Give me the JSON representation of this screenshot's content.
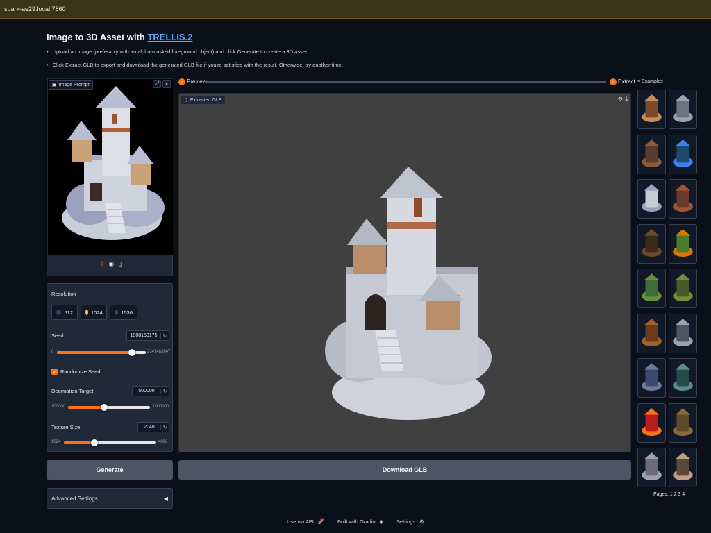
{
  "browser": {
    "url": "spark-ae29.local:7860"
  },
  "header": {
    "title_prefix": "Image to 3D Asset with ",
    "title_link": "TRELLIS.2",
    "instructions": [
      "Upload an image (preferably with an alpha-masked foreground object) and click Generate to create a 3D asset.",
      "Click Extract GLB to export and download the generated GLB file if you're satisfied with the result. Otherwise, try another time."
    ]
  },
  "image_prompt": {
    "label": "Image Prompt"
  },
  "settings": {
    "resolution_label": "Resolution",
    "resolution_options": [
      "512",
      "1024",
      "1536"
    ],
    "resolution_selected": "1024",
    "seed_label": "Seed",
    "seed_value": "1808159175",
    "seed_min": "0",
    "seed_max": "2147483647",
    "seed_fraction": 0.84,
    "randomize_label": "Randomize Seed",
    "randomize_checked": true,
    "decimation_label": "Decimation Target",
    "decimation_value": "500000",
    "decimation_min": "100000",
    "decimation_max": "1000000",
    "decimation_fraction": 0.44,
    "texture_label": "Texture Size",
    "texture_value": "2048",
    "texture_min": "1024",
    "texture_max": "4096",
    "texture_fraction": 0.33
  },
  "buttons": {
    "generate": "Generate",
    "download": "Download GLB",
    "advanced": "Advanced Settings"
  },
  "stepper": {
    "preview": "Preview",
    "extract": "Extract"
  },
  "viewer": {
    "label": "Extracted GLB"
  },
  "examples": {
    "label": "Examples",
    "pages_label": "Pages:",
    "pages": "1 2 3 4"
  },
  "footer": {
    "api": "Use via API",
    "gradio": "Built with Gradio",
    "settings": "Settings",
    "sep": "·"
  }
}
